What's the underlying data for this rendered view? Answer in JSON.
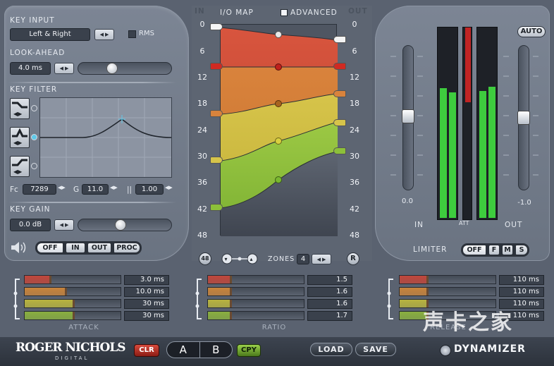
{
  "key_input": {
    "label": "KEY INPUT",
    "value": "Left & Right",
    "rms_label": "RMS"
  },
  "look_ahead": {
    "label": "LOOK-AHEAD",
    "value": "4.0 ms",
    "slider_fraction": 0.35
  },
  "key_filter": {
    "label": "KEY FILTER",
    "fc_label": "Fc",
    "fc_value": "7289",
    "g_label": "G",
    "g_value": "11.0",
    "q_label": "||",
    "q_value": "1.00"
  },
  "key_gain": {
    "label": "KEY GAIN",
    "value": "0.0 dB",
    "slider_fraction": 0.46
  },
  "monitor": {
    "buttons": [
      "OFF",
      "IN",
      "OUT",
      "PROC"
    ],
    "active": "OFF"
  },
  "io_map": {
    "in_label": "IN",
    "title": "I/O MAP",
    "advanced_label": "ADVANCED",
    "out_label": "OUT",
    "left_ticks": [
      "0",
      "6",
      "12",
      "18",
      "24",
      "30",
      "36",
      "42",
      "48"
    ],
    "right_ticks": [
      "0",
      "6",
      "12",
      "18",
      "24",
      "30",
      "36",
      "42",
      "48"
    ],
    "zones_label": "ZONES",
    "zones_value": "4",
    "btn_left": "48",
    "btn_right": "R"
  },
  "limiter": {
    "label": "LIMITER",
    "buttons": [
      "OFF",
      "F",
      "M",
      "S"
    ],
    "active": "OFF"
  },
  "meters": {
    "in_label": "IN",
    "att_label": "ATT",
    "out_label": "OUT",
    "in_value": "0.0",
    "out_value": "-1.0",
    "auto_label": "AUTO"
  },
  "attack": {
    "label": "ATTACK",
    "rows": [
      {
        "value": "3.0 ms",
        "color": "#c0473c",
        "fraction": 0.28
      },
      {
        "value": "10.0 ms",
        "color": "#c8843c",
        "fraction": 0.44
      },
      {
        "value": "30 ms",
        "color": "#b8b440",
        "fraction": 0.52
      },
      {
        "value": "30 ms",
        "color": "#8ab040",
        "fraction": 0.52
      }
    ]
  },
  "ratio": {
    "label": "RATIO",
    "rows": [
      {
        "value": "1.5",
        "color": "#c0473c",
        "fraction": 0.25
      },
      {
        "value": "1.6",
        "color": "#c8843c",
        "fraction": 0.25
      },
      {
        "value": "1.6",
        "color": "#b8b440",
        "fraction": 0.25
      },
      {
        "value": "1.7",
        "color": "#8ab040",
        "fraction": 0.25
      }
    ]
  },
  "release": {
    "label": "RELEASE",
    "rows": [
      {
        "value": "110 ms",
        "color": "#c0473c",
        "fraction": 0.3
      },
      {
        "value": "110 ms",
        "color": "#c8843c",
        "fraction": 0.3
      },
      {
        "value": "110 ms",
        "color": "#b8b440",
        "fraction": 0.3
      },
      {
        "value": "110 ms",
        "color": "#8ab040",
        "fraction": 0.3
      }
    ]
  },
  "footer": {
    "brand": "ROGER NICHOLS",
    "brand_sub": "DIGITAL",
    "clr": "CLR",
    "a": "A",
    "b": "B",
    "cpy": "CPY",
    "load": "LOAD",
    "save": "SAVE",
    "product": "DYNAMIZER"
  },
  "watermark": "声卡之家"
}
